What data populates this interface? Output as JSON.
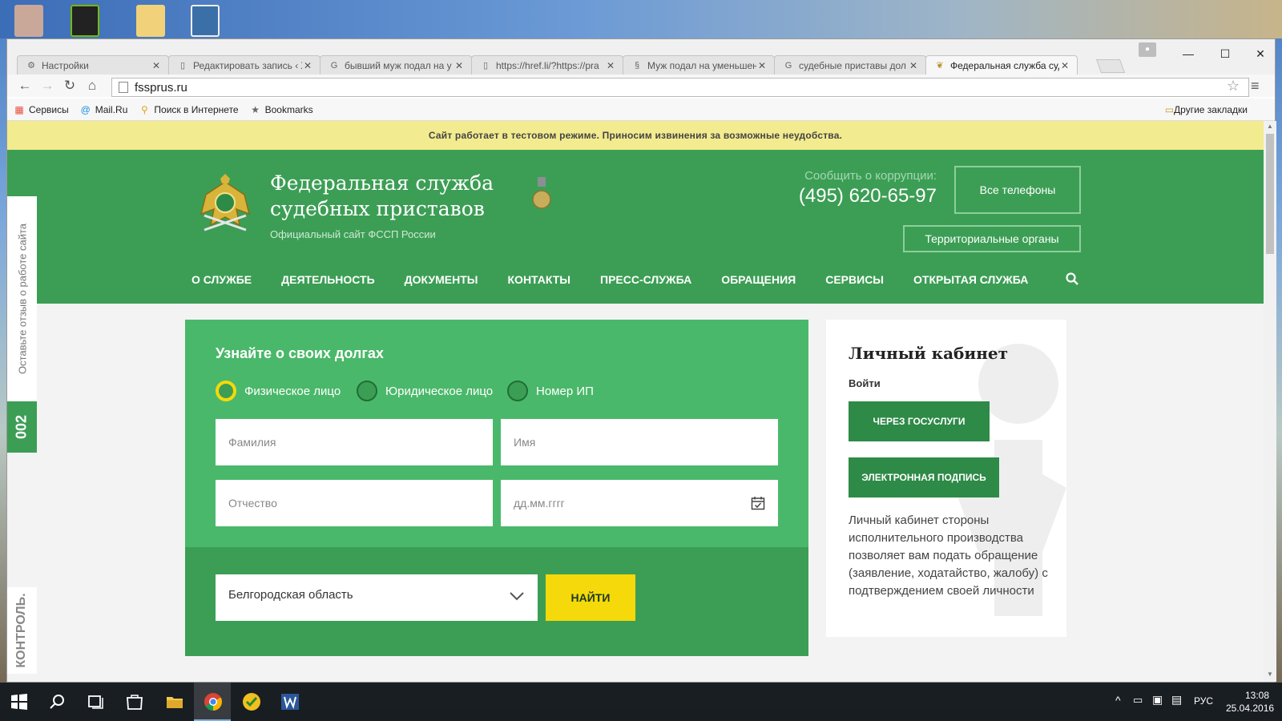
{
  "browser": {
    "tabs": [
      {
        "title": "Настройки",
        "icon": "gear-icon"
      },
      {
        "title": "Редактировать запись ‹ Ж",
        "icon": "page-icon"
      },
      {
        "title": "бывший муж подал на у",
        "icon": "google-icon"
      },
      {
        "title": "https://href.li/?https://pra",
        "icon": "page-icon"
      },
      {
        "title": "Муж подал на уменьшени",
        "icon": "section-icon"
      },
      {
        "title": "судебные приставы дол",
        "icon": "google-icon"
      },
      {
        "title": "Федеральная служба суд",
        "icon": "emblem-icon"
      }
    ],
    "url": "fssprus.ru",
    "bookmarks": [
      {
        "label": "Сервисы",
        "icon": "apps-icon"
      },
      {
        "label": "Mail.Ru",
        "icon": "mailru-icon"
      },
      {
        "label": "Поиск в Интернете",
        "icon": "search-web-icon"
      },
      {
        "label": "Bookmarks",
        "icon": "star-icon"
      }
    ],
    "other_bookmarks": "Другие закладки"
  },
  "page": {
    "notice": "Сайт работает в тестовом режиме. Приносим извинения за возможные неудобства.",
    "site_title": "Федеральная служба судебных приставов",
    "site_subtitle": "Официальный сайт ФССП России",
    "corruption_label": "Сообщить о коррупции:",
    "corruption_phone": "(495) 620-65-97",
    "all_phones": "Все телефоны",
    "territorial": "Территориальные органы",
    "nav": [
      "О СЛУЖБЕ",
      "ДЕЯТЕЛЬНОСТЬ",
      "ДОКУМЕНТЫ",
      "КОНТАКТЫ",
      "ПРЕСС-СЛУЖБА",
      "ОБРАЩЕНИЯ",
      "СЕРВИСЫ",
      "ОТКРЫТАЯ СЛУЖБА"
    ],
    "side_feedback": "Оставьте отзыв о работе сайта",
    "side_number": "002",
    "side_control": "КОНТРОЛЬ.",
    "debt": {
      "title": "Узнайте о своих долгах",
      "radios": [
        "Физическое лицо",
        "Юридическое лицо",
        "Номер ИП"
      ],
      "selected": "Физическое лицо",
      "placeholders": {
        "lastname": "Фамилия",
        "firstname": "Имя",
        "patronymic": "Отчество",
        "birthdate": "дд.мм.гггг"
      },
      "region": "Белгородская область",
      "find": "НАЙТИ"
    },
    "cabinet": {
      "title": "Личный кабинет",
      "login": "Войти",
      "gosuslugi": "ЧЕРЕЗ ГОСУСЛУГИ",
      "signature": "ЭЛЕКТРОННАЯ ПОДПИСЬ",
      "description": "Личный кабинет стороны исполнительного производства позволяет вам подать обращение (заявление, ходатайство, жалобу) с подтверждением своей личности"
    }
  },
  "colors": {
    "green": "#3c9e55",
    "light_green": "#4ab86a",
    "yellow": "#f5d90a",
    "notice_bg": "#f3eb8f"
  },
  "taskbar": {
    "lang": "РУС",
    "time": "13:08",
    "date": "25.04.2016"
  }
}
